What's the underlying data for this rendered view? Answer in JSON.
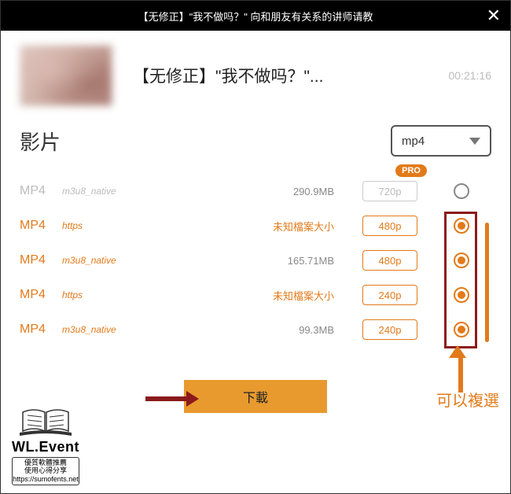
{
  "titlebar": {
    "text": "【无修正】\"我不做吗？\" 向和朋友有关系的讲师请教"
  },
  "video": {
    "title": "【无修正】\"我不做吗？\"...",
    "duration": "00:21:16"
  },
  "section": {
    "label": "影片"
  },
  "select": {
    "value": "mp4"
  },
  "badges": {
    "pro": "PRO"
  },
  "rows": [
    {
      "format": "MP4",
      "sub": "m3u8_native",
      "size": "290.9MB",
      "size_unknown": false,
      "res": "720p",
      "disabled": true,
      "selected": false
    },
    {
      "format": "MP4",
      "sub": "https",
      "size": "未知檔案大小",
      "size_unknown": true,
      "res": "480p",
      "disabled": false,
      "selected": true
    },
    {
      "format": "MP4",
      "sub": "m3u8_native",
      "size": "165.71MB",
      "size_unknown": false,
      "res": "480p",
      "disabled": false,
      "selected": true
    },
    {
      "format": "MP4",
      "sub": "https",
      "size": "未知檔案大小",
      "size_unknown": true,
      "res": "240p",
      "disabled": false,
      "selected": true
    },
    {
      "format": "MP4",
      "sub": "m3u8_native",
      "size": "99.3MB",
      "size_unknown": false,
      "res": "240p",
      "disabled": false,
      "selected": true
    }
  ],
  "download": {
    "label": "下載"
  },
  "annotations": {
    "multiselect": "可以複選"
  },
  "watermark": {
    "title": "WL.Event",
    "line1": "優質軟體推薦",
    "line2": "使用心得分享",
    "url": "https://sumofents.net"
  }
}
